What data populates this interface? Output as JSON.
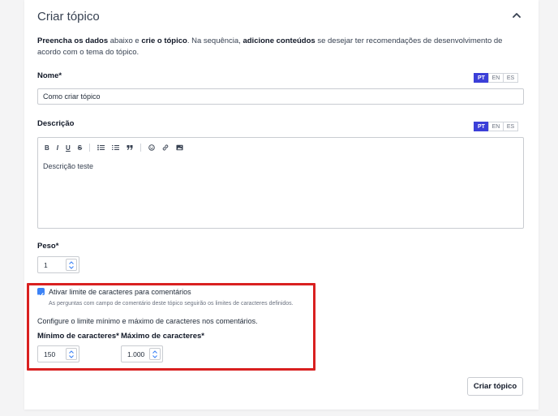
{
  "card": {
    "title": "Criar tópico"
  },
  "intro": {
    "p1": "Preencha os dados",
    "p2": " abaixo e ",
    "p3": "crie o tópico",
    "p4": ". Na sequência, ",
    "p5": "adicione conteúdos",
    "p6": " se desejar ter recomendações de desenvolvimento de acordo com o tema do tópico."
  },
  "languages": [
    "PT",
    "EN",
    "ES"
  ],
  "name_field": {
    "label": "Nome",
    "required": "*",
    "value": "Como criar tópico"
  },
  "description_field": {
    "label": "Descrição",
    "toolbar": [
      "B",
      "I",
      "U",
      "S",
      "list-bullet",
      "list-numbered",
      "quote",
      "emoji",
      "link",
      "image"
    ],
    "content": "Descrição teste"
  },
  "weight_field": {
    "label": "Peso",
    "required": "*",
    "value": "1"
  },
  "char_limit": {
    "checkbox_label": "Ativar limite de caracteres para comentários",
    "checked": true,
    "helper": "As perguntas com campo de comentário deste tópico seguirão os limites de caracteres definidos.",
    "configure_text": "Configure o limite mínimo e máximo de caracteres nos comentários.",
    "min_label": "Mínimo de caracteres",
    "min_value": "150",
    "max_label": "Máximo de caracteres",
    "max_value": "1.000",
    "required": "*"
  },
  "actions": {
    "submit_label": "Criar tópico"
  },
  "colors": {
    "accent": "#3b3fd8",
    "checkbox": "#3b82f6",
    "highlight": "#d92020"
  }
}
